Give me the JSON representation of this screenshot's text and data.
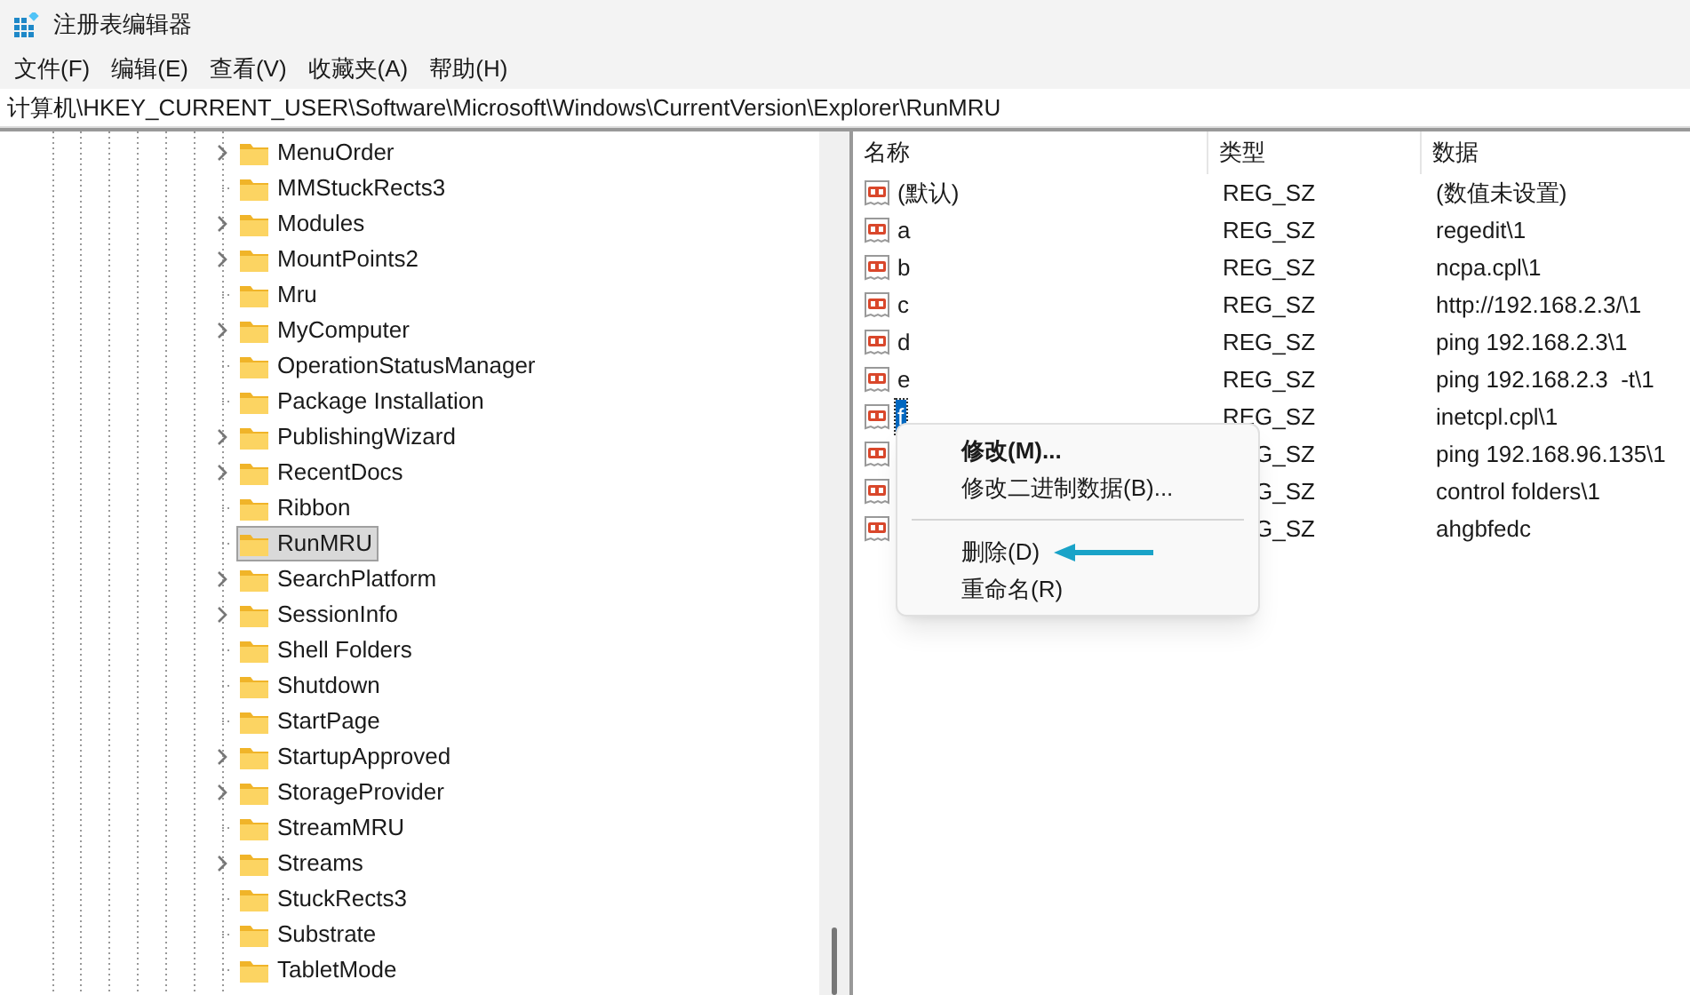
{
  "window": {
    "title": "注册表编辑器"
  },
  "menu": [
    {
      "label": "文件(F)"
    },
    {
      "label": "编辑(E)"
    },
    {
      "label": "查看(V)"
    },
    {
      "label": "收藏夹(A)"
    },
    {
      "label": "帮助(H)"
    }
  ],
  "address": "计算机\\HKEY_CURRENT_USER\\Software\\Microsoft\\Windows\\CurrentVersion\\Explorer\\RunMRU",
  "tree": [
    {
      "label": "MenuOrder",
      "expandable": true,
      "selected": false
    },
    {
      "label": "MMStuckRects3",
      "expandable": false,
      "selected": false
    },
    {
      "label": "Modules",
      "expandable": true,
      "selected": false
    },
    {
      "label": "MountPoints2",
      "expandable": true,
      "selected": false
    },
    {
      "label": "Mru",
      "expandable": false,
      "selected": false
    },
    {
      "label": "MyComputer",
      "expandable": true,
      "selected": false
    },
    {
      "label": "OperationStatusManager",
      "expandable": false,
      "selected": false
    },
    {
      "label": "Package Installation",
      "expandable": false,
      "selected": false
    },
    {
      "label": "PublishingWizard",
      "expandable": true,
      "selected": false
    },
    {
      "label": "RecentDocs",
      "expandable": true,
      "selected": false
    },
    {
      "label": "Ribbon",
      "expandable": false,
      "selected": false
    },
    {
      "label": "RunMRU",
      "expandable": false,
      "selected": true
    },
    {
      "label": "SearchPlatform",
      "expandable": true,
      "selected": false
    },
    {
      "label": "SessionInfo",
      "expandable": true,
      "selected": false
    },
    {
      "label": "Shell Folders",
      "expandable": false,
      "selected": false
    },
    {
      "label": "Shutdown",
      "expandable": false,
      "selected": false
    },
    {
      "label": "StartPage",
      "expandable": false,
      "selected": false
    },
    {
      "label": "StartupApproved",
      "expandable": true,
      "selected": false
    },
    {
      "label": "StorageProvider",
      "expandable": true,
      "selected": false
    },
    {
      "label": "StreamMRU",
      "expandable": false,
      "selected": false
    },
    {
      "label": "Streams",
      "expandable": true,
      "selected": false
    },
    {
      "label": "StuckRects3",
      "expandable": false,
      "selected": false
    },
    {
      "label": "Substrate",
      "expandable": false,
      "selected": false
    },
    {
      "label": "TabletMode",
      "expandable": false,
      "selected": false
    }
  ],
  "table": {
    "columns": [
      "名称",
      "类型",
      "数据"
    ],
    "rows": [
      {
        "name": "(默认)",
        "type": "REG_SZ",
        "data": "(数值未设置)",
        "selected": false
      },
      {
        "name": "a",
        "type": "REG_SZ",
        "data": "regedit\\1",
        "selected": false
      },
      {
        "name": "b",
        "type": "REG_SZ",
        "data": "ncpa.cpl\\1",
        "selected": false
      },
      {
        "name": "c",
        "type": "REG_SZ",
        "data": "http://192.168.2.3/\\1",
        "selected": false
      },
      {
        "name": "d",
        "type": "REG_SZ",
        "data": "ping 192.168.2.3\\1",
        "selected": false
      },
      {
        "name": "e",
        "type": "REG_SZ",
        "data": "ping 192.168.2.3  -t\\1",
        "selected": false
      },
      {
        "name": "f",
        "type": "REG_SZ",
        "data": "inetcpl.cpl\\1",
        "selected": true
      },
      {
        "type": "G_SZ",
        "data": "ping 192.168.96.135\\1"
      },
      {
        "type": "G_SZ",
        "data": "control folders\\1"
      },
      {
        "type": "G_SZ",
        "data": "ahgbfedc"
      }
    ]
  },
  "context_menu": [
    {
      "kind": "item",
      "label": "修改(M)...",
      "bold": true,
      "pointed": false
    },
    {
      "kind": "item",
      "label": "修改二进制数据(B)...",
      "bold": false,
      "pointed": false
    },
    {
      "kind": "separator"
    },
    {
      "kind": "item",
      "label": "删除(D)",
      "bold": false,
      "pointed": true
    },
    {
      "kind": "item",
      "label": "重命名(R)",
      "bold": false,
      "pointed": false
    }
  ]
}
